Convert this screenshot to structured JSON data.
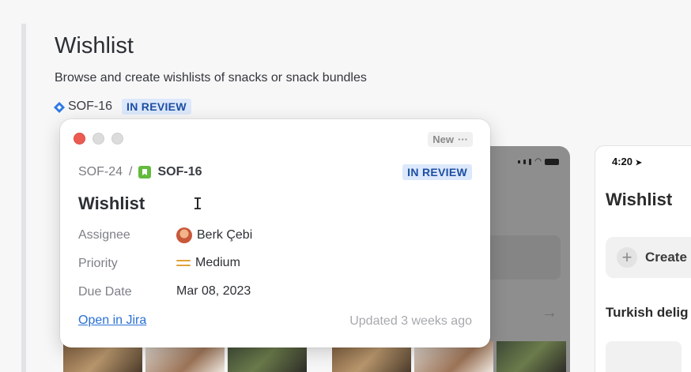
{
  "page": {
    "title": "Wishlist",
    "description": "Browse and create wishlists of snacks or snack bundles",
    "issue_key": "SOF-16",
    "issue_status": "IN REVIEW"
  },
  "popup": {
    "new_label": "New",
    "more_label": "···",
    "breadcrumb": {
      "parent": "SOF-24",
      "separator": "/",
      "current": "SOF-16"
    },
    "status": "IN REVIEW",
    "title": "Wishlist",
    "fields": [
      {
        "label": "Assignee",
        "value": "Berk Çebi"
      },
      {
        "label": "Priority",
        "value": "Medium"
      },
      {
        "label": "Due Date",
        "value": "Mar 08, 2023"
      }
    ],
    "open_link": "Open in Jira",
    "updated": "Updated 3 weeks ago"
  },
  "phone_preview": {
    "time": "4:20",
    "title": "Wishlist",
    "create_label": "Create",
    "section_label": "Turkish delig"
  },
  "colors": {
    "status_bg": "#dce8fb",
    "status_text": "#1d4fa3",
    "link": "#2a6fd6",
    "story_icon": "#63ba3c",
    "priority_medium": "#e0a23a"
  }
}
